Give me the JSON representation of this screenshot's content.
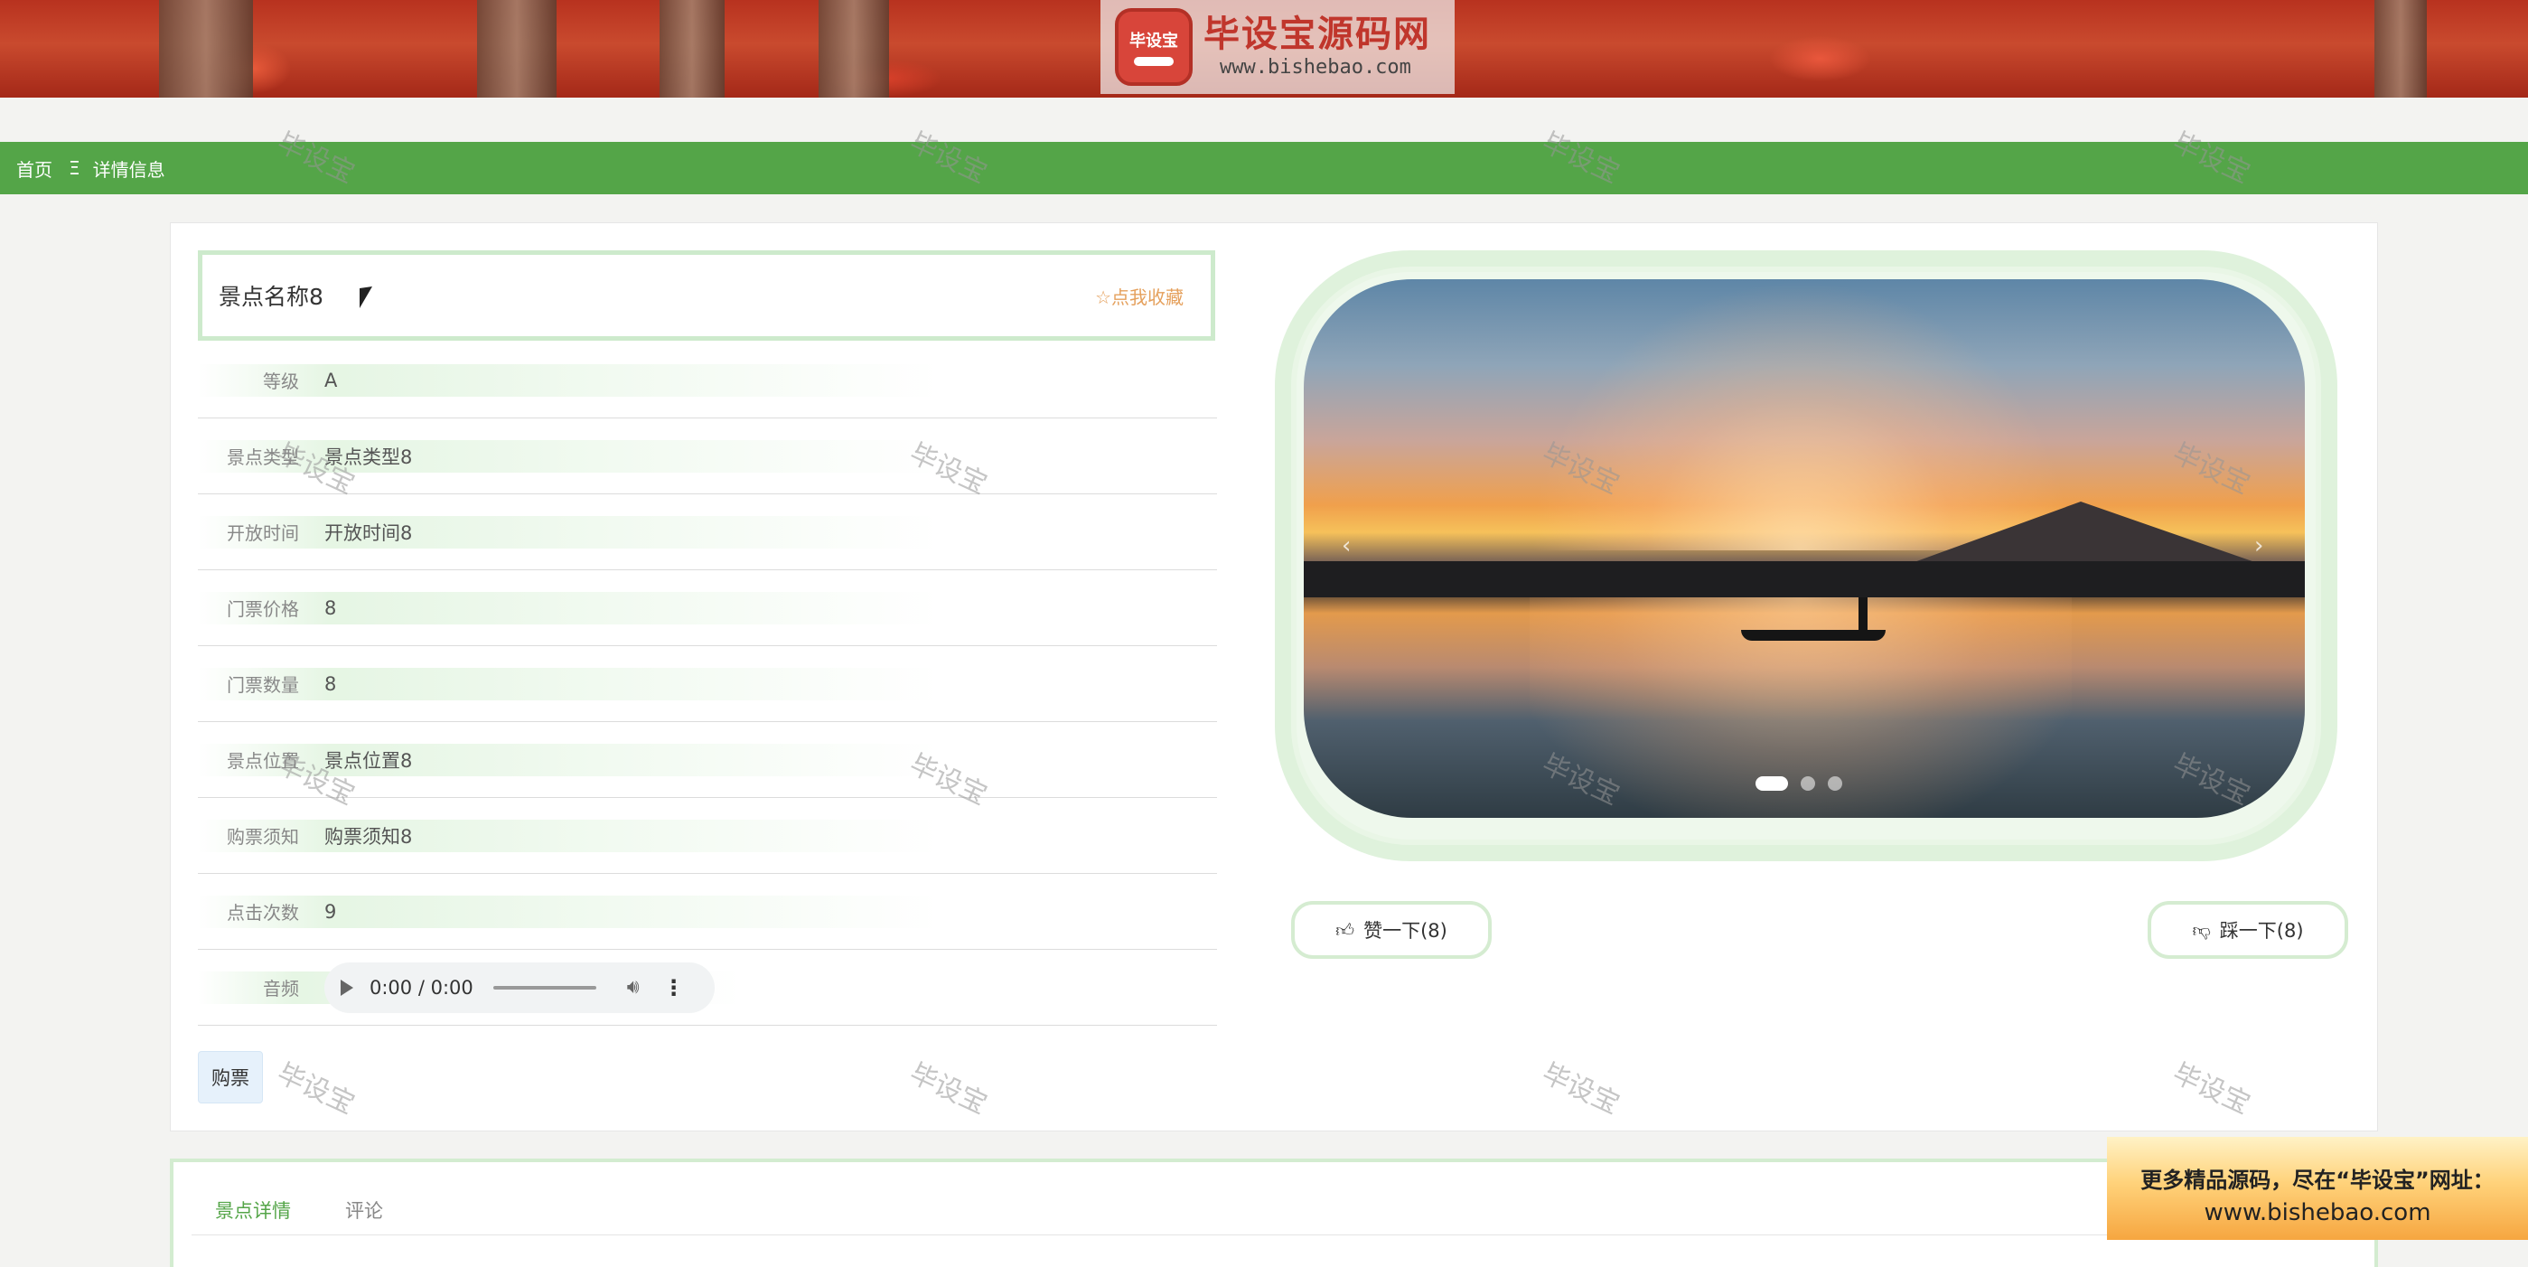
{
  "banner": {
    "logo_badge": "毕设宝",
    "logo_title": "毕设宝源码网",
    "logo_url": "www.bishebao.com"
  },
  "breadcrumb": {
    "home": "首页",
    "separator": "Ξ",
    "current": "详情信息"
  },
  "watermark_text": "毕设宝",
  "detail": {
    "title": "景点名称8",
    "favorite_label": "☆点我收藏",
    "fields": [
      {
        "label": "等级",
        "value": "A"
      },
      {
        "label": "景点类型",
        "value": "景点类型8"
      },
      {
        "label": "开放时间",
        "value": "开放时间8"
      },
      {
        "label": "门票价格",
        "value": "8"
      },
      {
        "label": "门票数量",
        "value": "8"
      },
      {
        "label": "景点位置",
        "value": "景点位置8"
      },
      {
        "label": "购票须知",
        "value": "购票须知8"
      },
      {
        "label": "点击次数",
        "value": "9"
      }
    ],
    "audio_label": "音频",
    "audio_time": "0:00 / 0:00",
    "buy_label": "购票"
  },
  "carousel": {
    "prev": "‹",
    "next": "›",
    "slide_count": 3,
    "active_slide": 1
  },
  "votes": {
    "like_label": "赞一下(8)",
    "dislike_label": "踩一下(8)"
  },
  "tabs": [
    {
      "label": "景点详情",
      "active": true
    },
    {
      "label": "评论",
      "active": false
    }
  ],
  "promo": {
    "line1": "更多精品源码，尽在“毕设宝”网址：",
    "line2": "www.bishebao.com"
  },
  "colors": {
    "accent_green": "#54a548",
    "favorite_orange": "#e5a05c",
    "light_green_border": "#cdeacc"
  },
  "icons": {
    "like": "thumbs-up-icon",
    "dislike": "thumbs-down-icon",
    "play": "play-icon",
    "volume": "volume-icon",
    "more": "more-vertical-icon"
  }
}
